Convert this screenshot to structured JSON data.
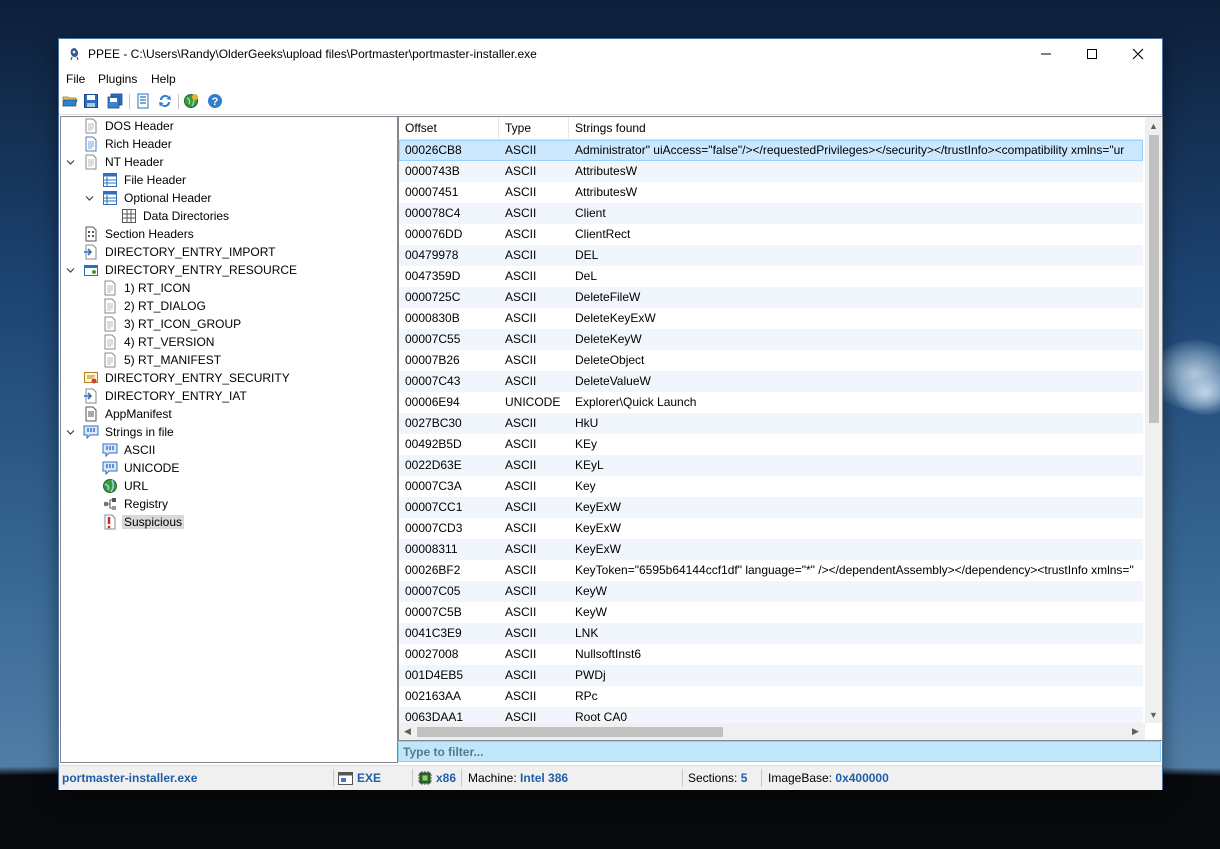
{
  "window": {
    "title": "PPEE - C:\\Users\\Randy\\OlderGeeks\\upload files\\Portmaster\\portmaster-installer.exe",
    "controls": {
      "minimize": "—",
      "maximize": "☐",
      "close": "✕"
    }
  },
  "menu": [
    "File",
    "Plugins",
    "Help"
  ],
  "toolbar": {
    "icons": [
      "open-folder-icon",
      "save-icon",
      "save-all-icon",
      "hex-view-icon",
      "refresh-icon",
      "plugin-globe-icon",
      "help-icon"
    ]
  },
  "tree": [
    {
      "label": "DOS Header",
      "indent": 0,
      "icon": "doc"
    },
    {
      "label": "Rich Header",
      "indent": 0,
      "icon": "doc-blue"
    },
    {
      "label": "NT Header",
      "indent": 0,
      "icon": "doc",
      "expanded": true
    },
    {
      "label": "File Header",
      "indent": 1,
      "icon": "table"
    },
    {
      "label": "Optional Header",
      "indent": 1,
      "icon": "table",
      "expanded": true
    },
    {
      "label": "Data Directories",
      "indent": 2,
      "icon": "grid"
    },
    {
      "label": "Section Headers",
      "indent": 0,
      "icon": "section"
    },
    {
      "label": "DIRECTORY_ENTRY_IMPORT",
      "indent": 0,
      "icon": "import"
    },
    {
      "label": "DIRECTORY_ENTRY_RESOURCE",
      "indent": 0,
      "icon": "resource",
      "expanded": true
    },
    {
      "label": "1) RT_ICON",
      "indent": 1,
      "icon": "doc"
    },
    {
      "label": "2) RT_DIALOG",
      "indent": 1,
      "icon": "doc"
    },
    {
      "label": "3) RT_ICON_GROUP",
      "indent": 1,
      "icon": "doc"
    },
    {
      "label": "4) RT_VERSION",
      "indent": 1,
      "icon": "doc"
    },
    {
      "label": "5) RT_MANIFEST",
      "indent": 1,
      "icon": "doc"
    },
    {
      "label": "DIRECTORY_ENTRY_SECURITY",
      "indent": 0,
      "icon": "certificate"
    },
    {
      "label": "DIRECTORY_ENTRY_IAT",
      "indent": 0,
      "icon": "import"
    },
    {
      "label": "AppManifest",
      "indent": 0,
      "icon": "manifest"
    },
    {
      "label": "Strings in file",
      "indent": 0,
      "icon": "strings",
      "expanded": true
    },
    {
      "label": "ASCII",
      "indent": 1,
      "icon": "strings"
    },
    {
      "label": "UNICODE",
      "indent": 1,
      "icon": "strings"
    },
    {
      "label": "URL",
      "indent": 1,
      "icon": "globe"
    },
    {
      "label": "Registry",
      "indent": 1,
      "icon": "registry"
    },
    {
      "label": "Suspicious",
      "indent": 1,
      "icon": "warning",
      "selected": true
    }
  ],
  "table": {
    "columns": [
      "Offset",
      "Type",
      "Strings found"
    ],
    "rows": [
      [
        "00026CB8",
        "ASCII",
        "Administrator\" uiAccess=\"false\"/></requestedPrivileges></security></trustInfo><compatibility xmlns=\"ur"
      ],
      [
        "0000743B",
        "ASCII",
        "AttributesW"
      ],
      [
        "00007451",
        "ASCII",
        "AttributesW"
      ],
      [
        "000078C4",
        "ASCII",
        "Client"
      ],
      [
        "000076DD",
        "ASCII",
        "ClientRect"
      ],
      [
        "00479978",
        "ASCII",
        "DEL"
      ],
      [
        "0047359D",
        "ASCII",
        "DeL"
      ],
      [
        "0000725C",
        "ASCII",
        "DeleteFileW"
      ],
      [
        "0000830B",
        "ASCII",
        "DeleteKeyExW"
      ],
      [
        "00007C55",
        "ASCII",
        "DeleteKeyW"
      ],
      [
        "00007B26",
        "ASCII",
        "DeleteObject"
      ],
      [
        "00007C43",
        "ASCII",
        "DeleteValueW"
      ],
      [
        "00006E94",
        "UNICODE",
        "Explorer\\Quick Launch"
      ],
      [
        "0027BC30",
        "ASCII",
        "HkU"
      ],
      [
        "00492B5D",
        "ASCII",
        "KEy"
      ],
      [
        "0022D63E",
        "ASCII",
        "KEyL"
      ],
      [
        "00007C3A",
        "ASCII",
        "Key"
      ],
      [
        "00007CC1",
        "ASCII",
        "KeyExW"
      ],
      [
        "00007CD3",
        "ASCII",
        "KeyExW"
      ],
      [
        "00008311",
        "ASCII",
        "KeyExW"
      ],
      [
        "00026BF2",
        "ASCII",
        "KeyToken=\"6595b64144ccf1df\" language=\"*\" /></dependentAssembly></dependency><trustInfo xmlns=\""
      ],
      [
        "00007C05",
        "ASCII",
        "KeyW"
      ],
      [
        "00007C5B",
        "ASCII",
        "KeyW"
      ],
      [
        "0041C3E9",
        "ASCII",
        "LNK"
      ],
      [
        "00027008",
        "ASCII",
        "NullsoftInst6"
      ],
      [
        "001D4EB5",
        "ASCII",
        "PWDj"
      ],
      [
        "002163AA",
        "ASCII",
        "RPc"
      ],
      [
        "0063DAA1",
        "ASCII",
        "Root CA0"
      ]
    ],
    "selected_row": 0
  },
  "filter": {
    "placeholder": "Type to filter..."
  },
  "status": {
    "filename": "portmaster-installer.exe",
    "filetype": "EXE",
    "arch": "x86",
    "machine_label": "Machine:",
    "machine_value": "Intel 386",
    "sections_label": "Sections:",
    "sections_value": "5",
    "imagebase_label": "ImageBase:",
    "imagebase_value": "0x400000"
  }
}
